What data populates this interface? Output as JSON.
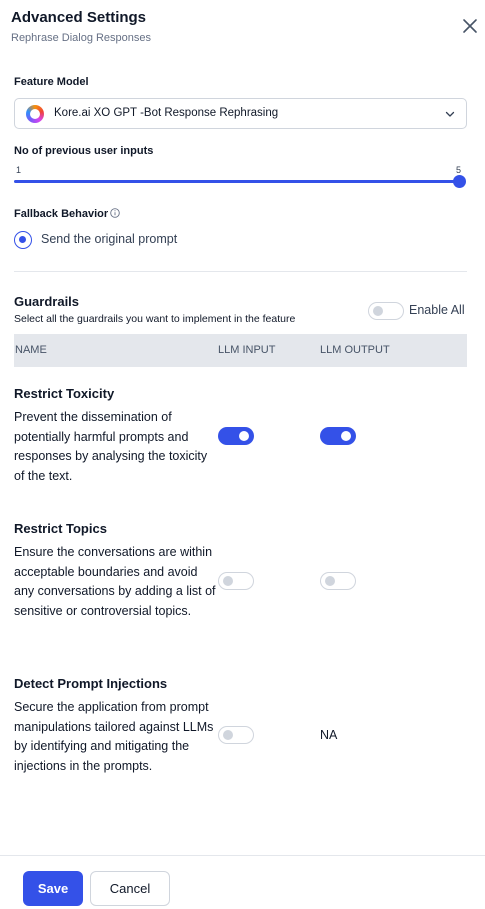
{
  "header": {
    "title": "Advanced Settings",
    "subtitle": "Rephrase Dialog Responses",
    "close_icon": "close-icon"
  },
  "feature_model": {
    "label": "Feature Model",
    "value": "Kore.ai XO GPT -Bot Response Rephrasing",
    "icon": "kore-logo-icon"
  },
  "previous_inputs": {
    "label": "No of previous user inputs",
    "min": "1",
    "max": "5",
    "value": 5
  },
  "fallback": {
    "label": "Fallback Behavior",
    "option": "Send the original prompt",
    "selected": true
  },
  "guardrails": {
    "title": "Guardrails",
    "description": "Select all the guardrails you want to implement in the feature",
    "enable_all_label": "Enable All",
    "enable_all": false,
    "columns": [
      "NAME",
      "LLM INPUT",
      "LLM OUTPUT"
    ],
    "rows": [
      {
        "name": "Restrict Toxicity",
        "description": "Prevent the dissemination of potentially harmful prompts and responses by analysing the toxicity of the text.",
        "llm_input": true,
        "llm_output": true
      },
      {
        "name": "Restrict Topics",
        "description": "Ensure the conversations are within acceptable boundaries and avoid any conversations by adding a list of sensitive or controversial topics.",
        "llm_input": false,
        "llm_output": false
      },
      {
        "name": "Detect Prompt Injections",
        "description": "Secure the application from prompt manipulations tailored against LLMs by identifying and mitigating the injections in the prompts.",
        "llm_input": false,
        "llm_output": "NA"
      }
    ]
  },
  "footer": {
    "save_label": "Save",
    "cancel_label": "Cancel"
  },
  "colors": {
    "accent": "#3451e8",
    "divider": "#e4e7ec",
    "muted_text": "#667085"
  }
}
